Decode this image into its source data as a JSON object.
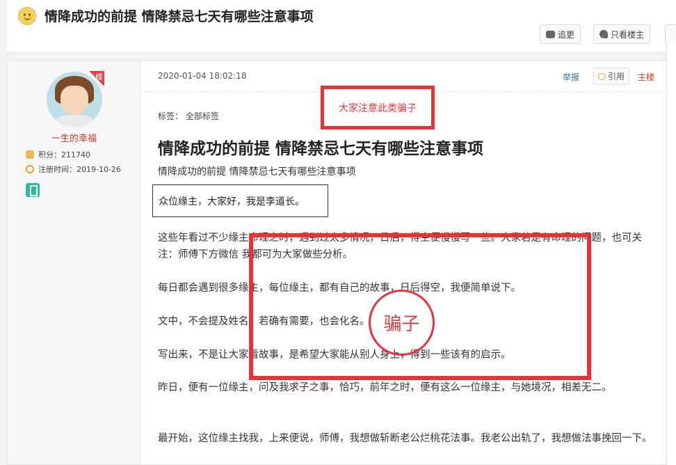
{
  "header": {
    "title": "情降成功的前提 情降禁忌七天有哪些注意事项",
    "follow_label": "追更",
    "only_owner_label": "只看楼主"
  },
  "user": {
    "floor_badge": "楼",
    "name": "一生的幸福",
    "points": "积分：211740",
    "register": "注册时间：2019-10-26"
  },
  "post": {
    "date": "2020-01-04 18:02:18",
    "report_label": "举报",
    "quote_label": "引用",
    "owner_label": "主楼",
    "tags": "标签：  全部标签",
    "alert_note": "大家注意此类骗子",
    "title": "情降成功的前提 情降禁忌七天有哪些注意事项",
    "subtitle": "情降成功的前提 情降禁忌七天有哪些注意事项",
    "greeting": "众位缘主，大家好，我是李道长。",
    "paragraphs": [
      "这些年看过不少缘主命理之时，遇到过太多情况，日后，得空便慢慢写一些。大家若是有命理的问题，也可关注：师傅下方微信 我都可为大家做些分析。",
      "每日都会遇到很多缘主，每位缘主，都有自己的故事，日后得空，我便简单说下。",
      "文中，不会提及姓名，若确有需要，也会化名。",
      "写出来，不是让大家看故事，是希望大家能从别人身上，得到一些该有的启示。",
      "昨日，便有一位缘主，问及我求子之事，恰巧，前年之时，便有这么一位缘主，与她境况，相差无二。",
      "最开始，这位缘主找我，上来便说，师傅，我想做斩断老公烂桃花法事。我老公出轨了，我想做法事挽回一下。"
    ],
    "scam_label": "骗子"
  },
  "colors": {
    "annotation_red": "#ea2f35",
    "link_blue": "#3a6ea5"
  }
}
